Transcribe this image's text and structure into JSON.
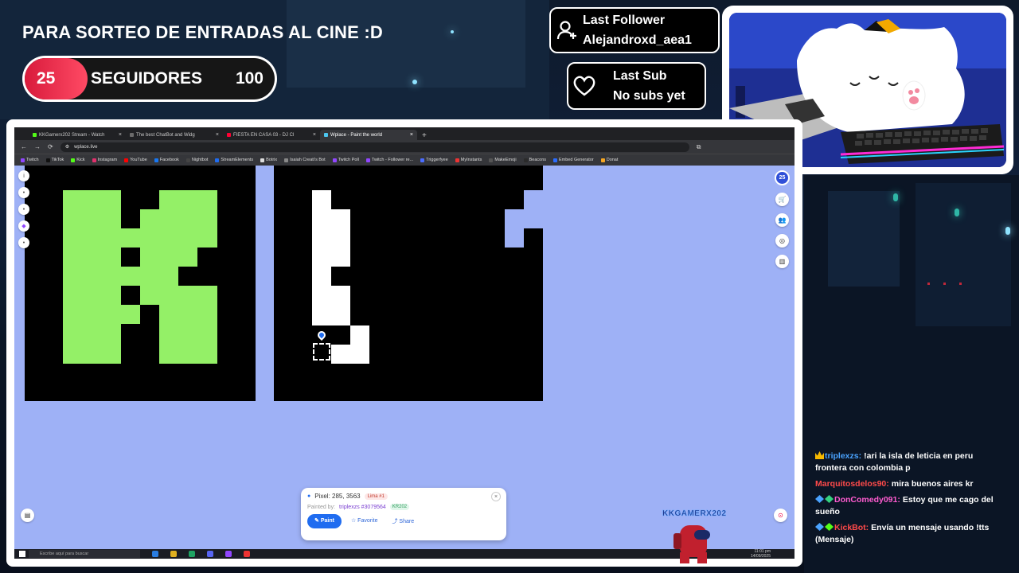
{
  "overlay": {
    "title": "PARA SORTEO DE ENTRADAS AL CINE :D",
    "goal": {
      "current": "25",
      "label": "SEGUIDORES",
      "target": "100",
      "progress": 0.25
    },
    "last_follower": {
      "heading": "Last Follower",
      "name": "Alejandroxd_aea1"
    },
    "last_sub": {
      "heading": "Last Sub",
      "name": "No subs yet"
    },
    "colors": {
      "accent": "#e0243f",
      "bg": "#0e1a2b"
    }
  },
  "browser": {
    "tabs": [
      {
        "label": "KKGamerx202 Stream - Watch",
        "icon": "kick-icon",
        "active": false
      },
      {
        "label": "The best ChatBot and Widg",
        "icon": "streamelements-icon",
        "active": false
      },
      {
        "label": "FIESTA EN CASA 03 - DJ Cl",
        "icon": "youtube-icon",
        "active": false
      },
      {
        "label": "Wplace - Paint the world",
        "icon": "wplace-icon",
        "active": true
      }
    ],
    "url": "wplace.live",
    "bookmarks": [
      "Twitch",
      "TikTok",
      "Kick",
      "Instagram",
      "YouTube",
      "Facebook",
      "Nightbot",
      "StreamElements",
      "Botrix",
      "Isaiah Creati's Bot",
      "Twitch Poll",
      "Twitch - Follower re...",
      "Triggerfyee",
      "MyInstants",
      "MakeEmoji",
      "Beacons",
      "Embed Generator",
      "Donat"
    ]
  },
  "wplace": {
    "droplets": "25",
    "pixel_panel": {
      "pixel_label": "Pixel: 285, 3563",
      "region": "Lima #1",
      "painted_by_label": "Painted by:",
      "painter": "triplexzs #3079564",
      "alliance": "KR202",
      "paint_label": "Paint",
      "favorite_label": "Favorite",
      "share_label": "Share"
    }
  },
  "taskbar": {
    "search_placeholder": "Escribe aquí para buscar",
    "time": "11:01 pm",
    "date": "14/09/2025"
  },
  "mascot": {
    "name": "KKGAMERX202"
  },
  "chat": [
    {
      "user": "triplexzs:",
      "user_color": "#4aa3ff",
      "text": "!ari la isla de leticia en peru frontera con colombia p",
      "badges": [
        "crown"
      ]
    },
    {
      "user": "Marquitosdelos90:",
      "user_color": "#ff4a4a",
      "text": "mira buenos aires kr",
      "badges": []
    },
    {
      "user": "DonComedy091:",
      "user_color": "#ff5cd0",
      "text": "Estoy que me cago del sueño",
      "badges": [
        "sword",
        "gem"
      ]
    },
    {
      "user": "KickBot:",
      "user_color": "#ff4a4a",
      "text": "Envía un mensaje usando !tts (Mensaje)",
      "badges": [
        "sword",
        "bot"
      ]
    }
  ]
}
